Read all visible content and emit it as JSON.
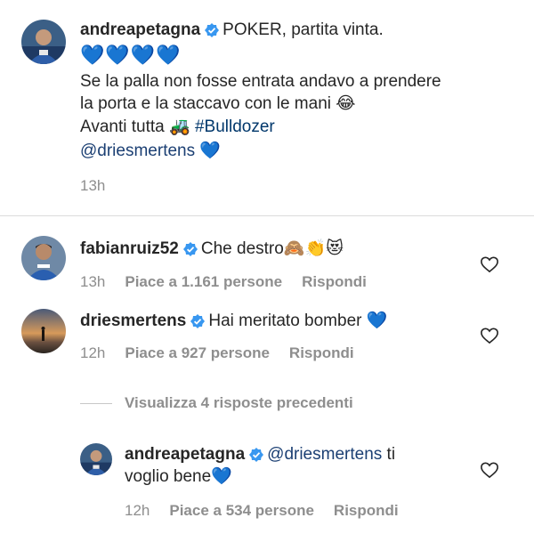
{
  "post": {
    "username": "andreapetagna",
    "caption_first": "POKER, partita vinta.",
    "hearts": "💙💙💙💙",
    "line2": "Se la palla non fosse entrata andavo a prendere",
    "line3": "la porta e la staccavo con le mani",
    "line3_emoji": "😂",
    "line4_text": "Avanti tutta",
    "line4_emoji": "🚜",
    "hashtag": "#Bulldozer",
    "mention": "@driesmertens",
    "mention_emoji": "💙",
    "time": "13h"
  },
  "comments": [
    {
      "username": "fabianruiz52",
      "text": "Che destro",
      "emojis": "🙈👏😻",
      "time": "13h",
      "likes": "Piace a 1.161 persone",
      "reply": "Rispondi"
    },
    {
      "username": "driesmertens",
      "text": "Hai meritato bomber",
      "emojis": "💙",
      "time": "12h",
      "likes": "Piace a 927 persone",
      "reply": "Rispondi"
    }
  ],
  "view_previous": "Visualizza 4 risposte precedenti",
  "reply": {
    "username": "andreapetagna",
    "mention": "@driesmertens",
    "text_a": "ti",
    "text_b": "voglio bene",
    "emoji": "💙",
    "time": "12h",
    "likes": "Piace a 534 persone",
    "reply": "Rispondi"
  },
  "colors": {
    "verified": "#3897f0",
    "link": "#00376b",
    "muted": "#8e8e8e"
  }
}
